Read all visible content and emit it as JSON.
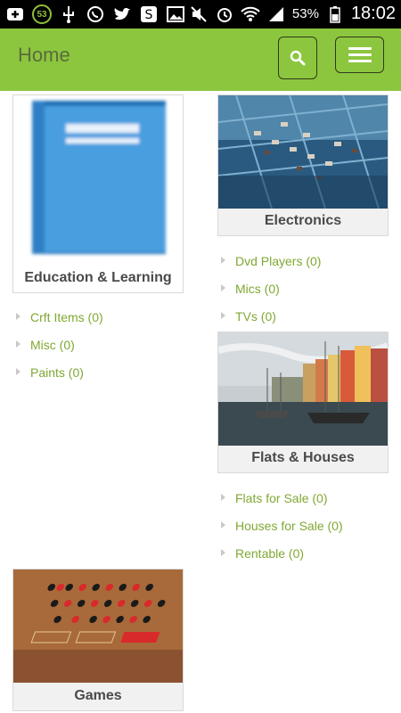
{
  "status": {
    "battery": "53%",
    "time": "18:02",
    "badge": "53"
  },
  "appbar": {
    "title": "Home"
  },
  "categories": {
    "education": {
      "label": "Education & Learning",
      "items": [
        "Crft Items (0)",
        "Misc (0)",
        "Paints (0)"
      ]
    },
    "electronics": {
      "label": "Electronics",
      "items": [
        "Dvd Players (0)",
        "Mics (0)",
        "TVs (0)"
      ]
    },
    "flats": {
      "label": "Flats & Houses",
      "items": [
        "Flats for Sale (0)",
        "Houses for Sale (0)",
        "Rentable (0)"
      ]
    },
    "games": {
      "label": "Games"
    }
  },
  "colors": {
    "accent": "#8cc63f",
    "link": "#7fa832"
  }
}
